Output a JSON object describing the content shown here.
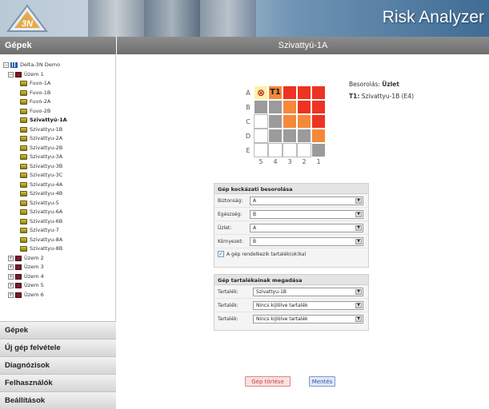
{
  "header": {
    "app_title": "Risk Analyzer",
    "logo_text": "3N"
  },
  "sidebar": {
    "title": "Gépek",
    "tree": [
      {
        "label": "Delta-3N Demo",
        "level": 0,
        "icon": "root-icon",
        "expander": "−"
      },
      {
        "label": "Üzem 1",
        "level": 1,
        "icon": "plant-icon",
        "expander": "−"
      },
      {
        "label": "Fuvo-1A",
        "level": 2,
        "icon": "machine-icon"
      },
      {
        "label": "Fuvo-1B",
        "level": 2,
        "icon": "machine-icon"
      },
      {
        "label": "Fuvo-2A",
        "level": 2,
        "icon": "machine-icon"
      },
      {
        "label": "Fuvo-2B",
        "level": 2,
        "icon": "machine-icon"
      },
      {
        "label": "Szivattyú-1A",
        "level": 2,
        "icon": "machine-icon",
        "selected": true
      },
      {
        "label": "Szivattyu-1B",
        "level": 2,
        "icon": "machine-icon"
      },
      {
        "label": "Szivattyu-2A",
        "level": 2,
        "icon": "machine-icon"
      },
      {
        "label": "Szivattyu-2B",
        "level": 2,
        "icon": "machine-icon"
      },
      {
        "label": "Szivattyu-3A",
        "level": 2,
        "icon": "machine-icon"
      },
      {
        "label": "Szivattyu-3B",
        "level": 2,
        "icon": "machine-icon"
      },
      {
        "label": "Szivattyu-3C",
        "level": 2,
        "icon": "machine-icon"
      },
      {
        "label": "Szivattyu-4A",
        "level": 2,
        "icon": "machine-icon"
      },
      {
        "label": "Szivattyu-4B",
        "level": 2,
        "icon": "machine-icon"
      },
      {
        "label": "Szivattyu-5",
        "level": 2,
        "icon": "machine-icon"
      },
      {
        "label": "Szivattyu-6A",
        "level": 2,
        "icon": "machine-icon"
      },
      {
        "label": "Szivattyu-6B",
        "level": 2,
        "icon": "machine-icon"
      },
      {
        "label": "Szivattyu-7",
        "level": 2,
        "icon": "machine-icon"
      },
      {
        "label": "Szivattyu-8A",
        "level": 2,
        "icon": "machine-icon"
      },
      {
        "label": "Szivattyu-8B",
        "level": 2,
        "icon": "machine-icon"
      },
      {
        "label": "Üzem 2",
        "level": 1,
        "icon": "plant-icon",
        "expander": "+"
      },
      {
        "label": "Üzem 3",
        "level": 1,
        "icon": "plant-icon",
        "expander": "+"
      },
      {
        "label": "Üzem 4",
        "level": 1,
        "icon": "plant-icon",
        "expander": "+"
      },
      {
        "label": "Üzem 5",
        "level": 1,
        "icon": "plant-icon",
        "expander": "+"
      },
      {
        "label": "Üzem 6",
        "level": 1,
        "icon": "plant-icon",
        "expander": "+"
      }
    ]
  },
  "nav": [
    {
      "label": "Gépek"
    },
    {
      "label": "Új gép felvétele"
    },
    {
      "label": "Diagnózisok"
    },
    {
      "label": "Felhasználók"
    },
    {
      "label": "Beállítások"
    }
  ],
  "main": {
    "title": "Szivattyú-1A",
    "matrix": {
      "row_labels": [
        "A",
        "B",
        "C",
        "D",
        "E"
      ],
      "col_labels": [
        "5",
        "4",
        "3",
        "2",
        "1"
      ],
      "cells": [
        [
          "yellow",
          "orange",
          "red",
          "red",
          "red"
        ],
        [
          "grey",
          "grey",
          "orange",
          "red",
          "red"
        ],
        [
          "white",
          "grey",
          "orange",
          "orange",
          "red"
        ],
        [
          "white",
          "grey",
          "grey",
          "grey",
          "orange"
        ],
        [
          "white",
          "white",
          "white",
          "white",
          "grey"
        ]
      ],
      "colors": {
        "red": "#ee3322",
        "orange": "#f5893a",
        "grey": "#9b9b9b",
        "white": "#ffffff",
        "yellow": "#fff0a8"
      },
      "markers": [
        {
          "row": 0,
          "col": 0,
          "symbol": "⊗",
          "label": ""
        },
        {
          "row": 0,
          "col": 1,
          "symbol": "",
          "label": "T1"
        }
      ]
    },
    "classification": {
      "label": "Besorolás:",
      "value": "Üzlet",
      "t1_key": "T1:",
      "t1_value": "Szivattyu-1B (E4)"
    },
    "risk_panel": {
      "title": "Gép kockázati besorolása",
      "fields": [
        {
          "label": "Biztonság:",
          "value": "A"
        },
        {
          "label": "Egészség:",
          "value": "B"
        },
        {
          "label": "Üzlet:",
          "value": "A"
        },
        {
          "label": "Környezet:",
          "value": "B"
        }
      ],
      "checkbox_label": "A gép rendelkezik tartalék(ok)kal",
      "checkbox_checked": true
    },
    "spares_panel": {
      "title": "Gép tartalékainak megadása",
      "fields": [
        {
          "label": "Tartalék:",
          "value": "Szivattyu-1B"
        },
        {
          "label": "Tartalék:",
          "value": "Nincs kijlölve tartalék"
        },
        {
          "label": "Tartalék:",
          "value": "Nincs kijlölve tartalék"
        }
      ]
    },
    "buttons": {
      "delete_label": "Gép törlése",
      "save_label": "Mentés"
    }
  }
}
